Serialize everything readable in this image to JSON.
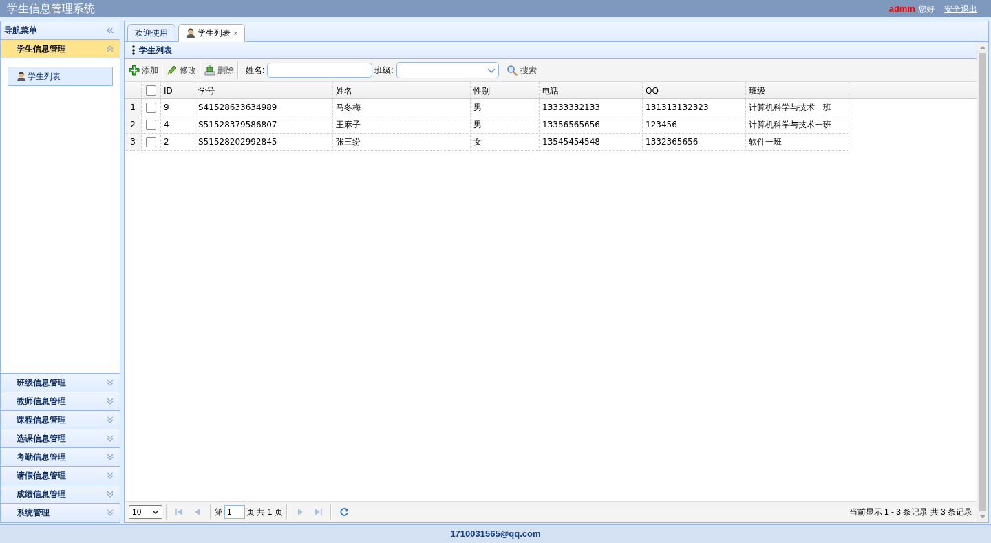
{
  "header": {
    "title": "学生信息管理系统",
    "user": "admin",
    "greeting": "您好",
    "logout": "安全退出"
  },
  "sidebar": {
    "title": "导航菜单",
    "sections": [
      {
        "label": "学生信息管理",
        "expanded": true,
        "items": [
          {
            "label": "学生列表",
            "selected": true
          }
        ]
      },
      {
        "label": "班级信息管理",
        "expanded": false
      },
      {
        "label": "教师信息管理",
        "expanded": false
      },
      {
        "label": "课程信息管理",
        "expanded": false
      },
      {
        "label": "选课信息管理",
        "expanded": false
      },
      {
        "label": "考勤信息管理",
        "expanded": false
      },
      {
        "label": "请假信息管理",
        "expanded": false
      },
      {
        "label": "成绩信息管理",
        "expanded": false
      },
      {
        "label": "系统管理",
        "expanded": false
      }
    ]
  },
  "tabs": [
    {
      "label": "欢迎使用",
      "selected": false,
      "has_icon": false
    },
    {
      "label": "学生列表",
      "selected": true,
      "has_icon": true,
      "close": "×"
    }
  ],
  "grid": {
    "title": "学生列表",
    "toolbar": [
      {
        "kind": "add",
        "label": "添加"
      },
      {
        "kind": "edit",
        "label": "修改"
      },
      {
        "kind": "delete",
        "label": "删除"
      }
    ],
    "filters": [
      {
        "kind": "text",
        "label": "姓名:"
      },
      {
        "kind": "select",
        "label": "班级:"
      }
    ],
    "search": "搜索",
    "header_checked": false,
    "columns": [
      "ID",
      "学号",
      "姓名",
      "性别",
      "电话",
      "QQ",
      "班级"
    ],
    "rows": [
      {
        "number": "1",
        "checked": false,
        "cells": [
          "9",
          "S41528633634989",
          "马冬梅",
          "男",
          "13333332133",
          "131313132323",
          "计算机科学与技术一班"
        ]
      },
      {
        "number": "2",
        "checked": false,
        "cells": [
          "4",
          "S51528379586807",
          "王麻子",
          "男",
          "13356565656",
          "123456",
          "计算机科学与技术一班"
        ]
      },
      {
        "number": "3",
        "checked": false,
        "cells": [
          "2",
          "S51528202992845",
          "张三纷",
          "女",
          "13545454548",
          "1332365656",
          "软件一班"
        ]
      }
    ]
  },
  "pagination": {
    "page_size": "10",
    "nav": [
      {
        "kind": "first",
        "disabled": true
      },
      {
        "kind": "prev",
        "disabled": true
      },
      {
        "kind": "next",
        "disabled": true
      },
      {
        "kind": "last",
        "disabled": true
      }
    ],
    "page_prefix": "第",
    "page": "1",
    "page_suffix": "页 共 1 页",
    "display": "当前显示 1 - 3 条记录 共 3 条记录"
  },
  "footer": {
    "text": "1710031565@qq.com"
  }
}
